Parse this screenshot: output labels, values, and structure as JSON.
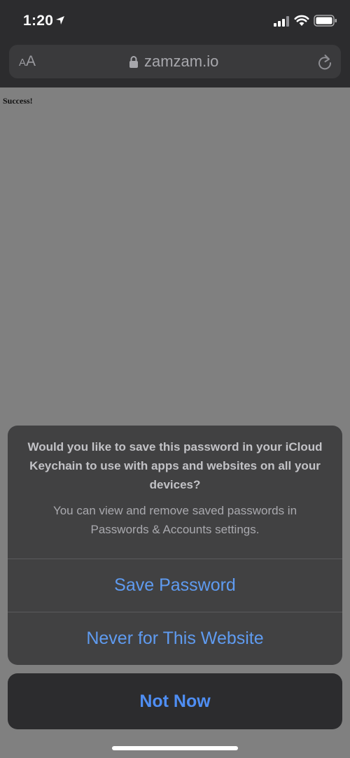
{
  "status_bar": {
    "time": "1:20",
    "icons": [
      "location-icon",
      "signal-icon",
      "wifi-icon",
      "battery-icon"
    ]
  },
  "address_bar": {
    "text_size_small": "A",
    "text_size_large": "A",
    "url": "zamzam.io",
    "icons": [
      "lock-icon",
      "reload-icon"
    ]
  },
  "page": {
    "message": "Success!"
  },
  "save_password_sheet": {
    "title": "Would you like to save this password in your iCloud Keychain to use with apps and websites on all your devices?",
    "message": "You can view and remove saved passwords in Passwords & Accounts settings.",
    "actions": [
      {
        "label": "Save Password"
      },
      {
        "label": "Never for This Website"
      }
    ],
    "cancel_label": "Not Now"
  },
  "colors": {
    "action_blue": "#5f9bf0",
    "sheet_background": "#414142",
    "page_background": "#808080"
  }
}
